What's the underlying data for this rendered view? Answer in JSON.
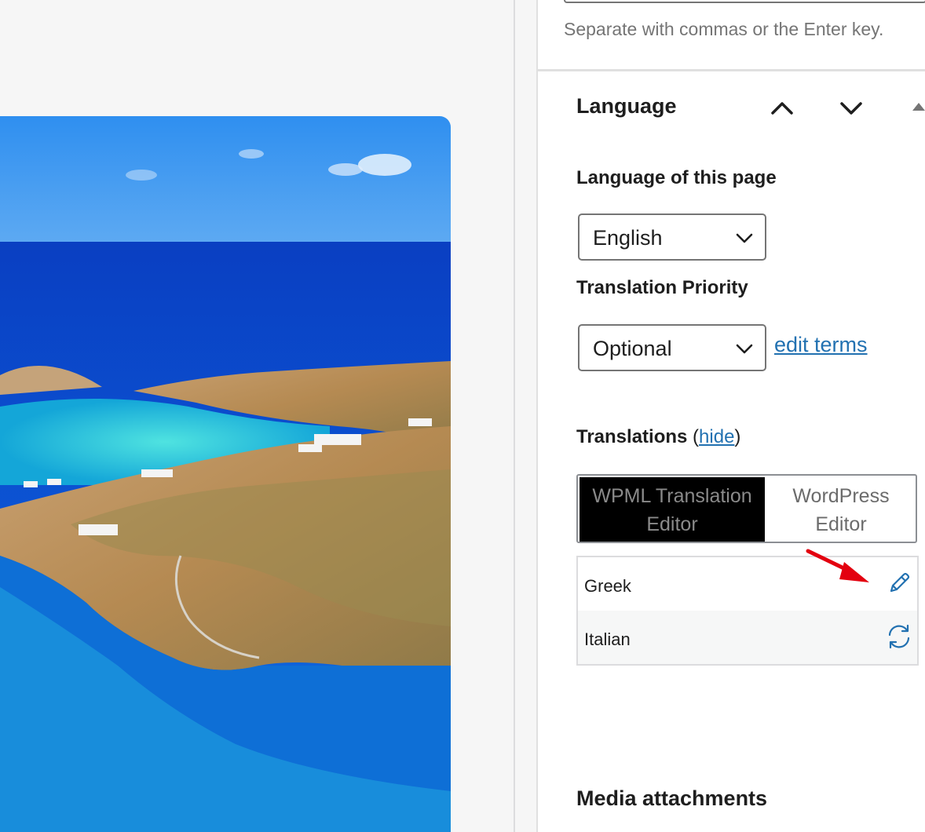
{
  "tags": {
    "help_text": "Separate with commas or the Enter key."
  },
  "language_panel": {
    "title": "Language",
    "move_up_icon": "chevron-up-icon",
    "move_down_icon": "chevron-down-icon",
    "collapse_icon": "triangle-up-icon",
    "language_label": "Language of this page",
    "language_value": "English",
    "priority_label": "Translation Priority",
    "priority_value": "Optional",
    "edit_terms_link": "edit terms",
    "translations_label": "Translations",
    "translations_open_paren": " (",
    "hide_link": "hide",
    "translations_close_paren": ")",
    "editor_options": [
      {
        "label": "WPML Translation Editor",
        "selected": true
      },
      {
        "label": "WordPress Editor",
        "selected": false
      }
    ],
    "translations": [
      {
        "language": "Greek",
        "action_icon": "pencil-icon"
      },
      {
        "language": "Italian",
        "action_icon": "refresh-icon"
      }
    ]
  },
  "media_panel": {
    "title": "Media attachments"
  },
  "colors": {
    "accent": "#2271b1",
    "annotation_arrow": "#e3000f"
  }
}
